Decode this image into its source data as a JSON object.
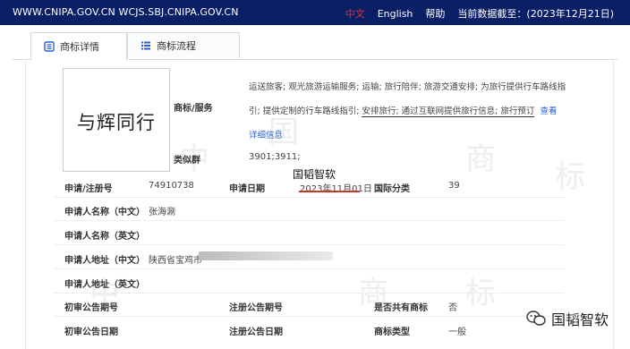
{
  "topbar": {
    "site": "WWW.CNIPA.GOV.CN WCJS.SBJ.CNIPA.GOV.CN",
    "lang_cn": "中文",
    "lang_en": "English",
    "help": "帮助",
    "data_as_of": "当前数据截至：(2023年12月21日)"
  },
  "tabs": [
    {
      "label": "商标详情",
      "icon": "document-list-icon"
    },
    {
      "label": "商标流程",
      "icon": "list-icon"
    }
  ],
  "logo": {
    "text": "与辉同行"
  },
  "fields": {
    "goods_label": "商标/服务",
    "services_line1": "运送旅客; 观光旅游运输服务; 运输; 旅行陪伴; 旅游交通安排; 为旅行提供行车路线指",
    "services_line2_a": "引; 提供定制的行车路线指引; ",
    "services_line2_b": "安排旅行; 通过互联网提供旅行信息; 旅行预订",
    "view_link": "查看",
    "detail_link": "详细信息",
    "similar_group_label": "类似群",
    "similar_group_value": "3901;3911;",
    "reg_no_label": "申请/注册号",
    "reg_no_value": "74910738",
    "apply_date_label": "申请日期",
    "apply_date_value": "2023年11月01日",
    "intl_class_label": "国际分类",
    "intl_class_value": "39",
    "applicant_cn_label": "申请人名称（中文）",
    "applicant_cn_value": "张海涮",
    "applicant_en_label": "申请人名称（英文）",
    "address_cn_label": "申请人地址（中文）",
    "address_cn_value": "陕西省宝鸡市",
    "address_en_label": "申请人地址（英文）",
    "prelim_no_label": "初审公告期号",
    "reg_pub_no_label": "注册公告期号",
    "shared_label": "是否共有商标",
    "shared_value": "否",
    "prelim_date_label": "初审公告日期",
    "reg_pub_date_label": "注册公告日期",
    "type_label": "商标类型",
    "type_value": "一般"
  },
  "annotation": {
    "title": "国韬智软"
  },
  "brand": {
    "name": "国韬智软",
    "icon": "wechat-icon"
  },
  "colors": {
    "topbar": "#0a1f66",
    "accent_red": "#c0392b",
    "link": "#2b5fd0"
  }
}
